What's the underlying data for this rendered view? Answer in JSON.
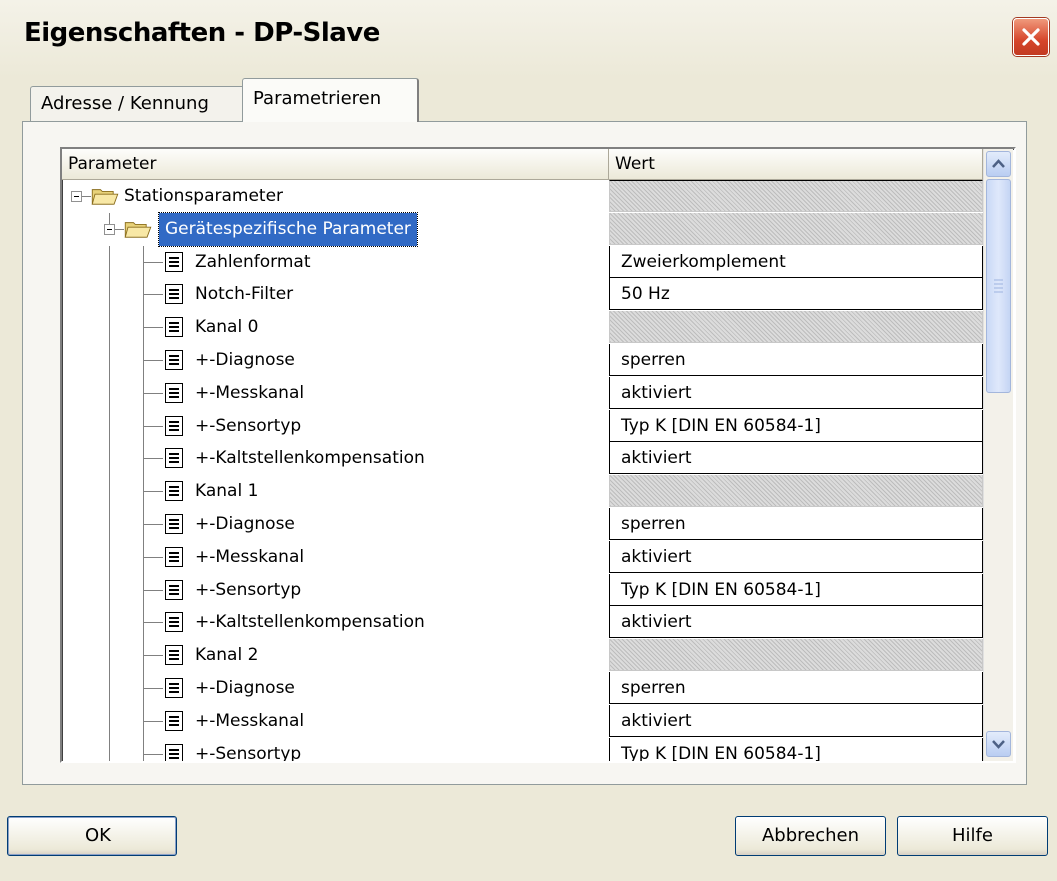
{
  "window": {
    "title": "Eigenschaften - DP-Slave"
  },
  "tabs": [
    {
      "label": "Adresse / Kennung",
      "active": false
    },
    {
      "label": "Parametrieren",
      "active": true
    }
  ],
  "grid": {
    "columns": [
      "Parameter",
      "Wert"
    ],
    "rows": [
      {
        "label": "Stationsparameter",
        "value": "",
        "icon": "folder-open-icon",
        "level": 0
      },
      {
        "label": "Gerätespezifische Parameter",
        "value": "",
        "icon": "folder-open-icon",
        "level": 1,
        "selected": true
      },
      {
        "label": "Zahlenformat",
        "value": "Zweierkomplement",
        "icon": "parameter-doc-icon",
        "level": 2
      },
      {
        "label": "Notch-Filter",
        "value": "50 Hz",
        "icon": "parameter-doc-icon",
        "level": 2
      },
      {
        "label": "Kanal 0",
        "value": "",
        "icon": "parameter-doc-icon",
        "level": 2
      },
      {
        "label": "+-Diagnose",
        "value": "sperren",
        "icon": "parameter-doc-icon",
        "level": 2
      },
      {
        "label": "+-Messkanal",
        "value": "aktiviert",
        "icon": "parameter-doc-icon",
        "level": 2
      },
      {
        "label": "+-Sensortyp",
        "value": "Typ K [DIN EN 60584-1]",
        "icon": "parameter-doc-icon",
        "level": 2
      },
      {
        "label": "+-Kaltstellenkompensation",
        "value": "aktiviert",
        "icon": "parameter-doc-icon",
        "level": 2
      },
      {
        "label": "Kanal 1",
        "value": "",
        "icon": "parameter-doc-icon",
        "level": 2
      },
      {
        "label": "+-Diagnose",
        "value": "sperren",
        "icon": "parameter-doc-icon",
        "level": 2
      },
      {
        "label": "+-Messkanal",
        "value": "aktiviert",
        "icon": "parameter-doc-icon",
        "level": 2
      },
      {
        "label": "+-Sensortyp",
        "value": "Typ K [DIN EN 60584-1]",
        "icon": "parameter-doc-icon",
        "level": 2
      },
      {
        "label": "+-Kaltstellenkompensation",
        "value": "aktiviert",
        "icon": "parameter-doc-icon",
        "level": 2
      },
      {
        "label": "Kanal 2",
        "value": "",
        "icon": "parameter-doc-icon",
        "level": 2
      },
      {
        "label": "+-Diagnose",
        "value": "sperren",
        "icon": "parameter-doc-icon",
        "level": 2
      },
      {
        "label": "+-Messkanal",
        "value": "aktiviert",
        "icon": "parameter-doc-icon",
        "level": 2
      },
      {
        "label": "+-Sensortyp",
        "value": "Typ K [DIN EN 60584-1]",
        "icon": "parameter-doc-icon",
        "level": 2
      }
    ]
  },
  "buttons": {
    "ok": "OK",
    "cancel": "Abbrechen",
    "help": "Hilfe"
  },
  "colors": {
    "selection": "#316ac5",
    "dialog_bg": "#ece9d8",
    "close_button": "#d6452b"
  }
}
